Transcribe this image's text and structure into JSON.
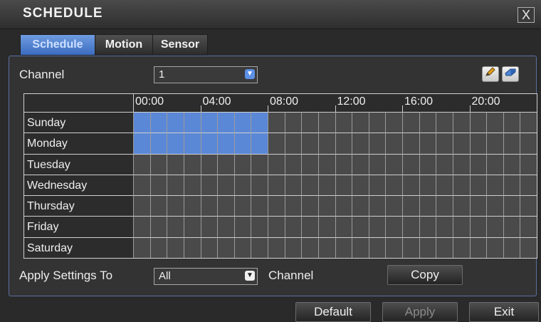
{
  "window": {
    "title": "SCHEDULE",
    "close_label": "X"
  },
  "tabs": [
    {
      "label": "Schedule",
      "active": true
    },
    {
      "label": "Motion",
      "active": false
    },
    {
      "label": "Sensor",
      "active": false
    }
  ],
  "channel": {
    "label": "Channel",
    "value": "1"
  },
  "toolbar": {
    "pencil_icon": "pencil-icon",
    "eraser_icon": "eraser-icon"
  },
  "schedule": {
    "time_headers": [
      "00:00",
      "04:00",
      "08:00",
      "12:00",
      "16:00",
      "20:00"
    ],
    "days": [
      {
        "name": "Sunday",
        "active_hours": [
          0,
          8
        ]
      },
      {
        "name": "Monday",
        "active_hours": [
          0,
          8
        ]
      },
      {
        "name": "Tuesday",
        "active_hours": []
      },
      {
        "name": "Wednesday",
        "active_hours": []
      },
      {
        "name": "Thursday",
        "active_hours": []
      },
      {
        "name": "Friday",
        "active_hours": []
      },
      {
        "name": "Saturday",
        "active_hours": []
      }
    ],
    "hours_per_day": 24,
    "colors": {
      "active": "#5b88d6",
      "inactive": "#4a4a4a"
    }
  },
  "apply": {
    "label": "Apply Settings To",
    "value": "All",
    "suffix": "Channel",
    "copy_label": "Copy"
  },
  "footer": {
    "default_label": "Default",
    "apply_label": "Apply",
    "exit_label": "Exit"
  }
}
